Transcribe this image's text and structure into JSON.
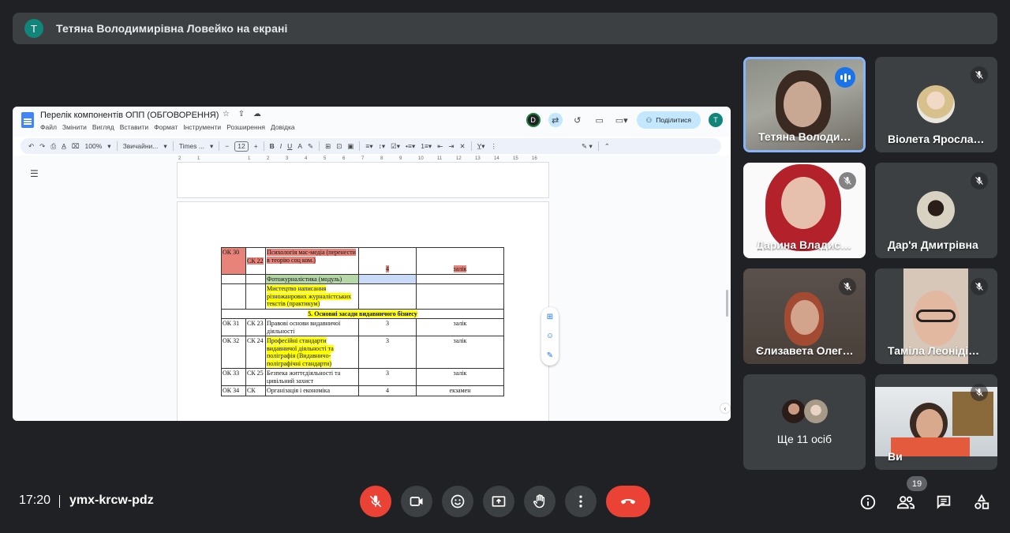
{
  "banner": {
    "avatar_letter": "Т",
    "text": "Тетяна Володимирівна Ловейко на екрані"
  },
  "doc": {
    "title": "Перелік компонентів ОПП (ОБГОВОРЕННЯ)",
    "menu": [
      "Файл",
      "Змінити",
      "Вигляд",
      "Вставити",
      "Формат",
      "Інструменти",
      "Розширення",
      "Довідка"
    ],
    "share_label": "Поділитися",
    "user_avatar": "T",
    "viewer_avatar": "D",
    "zoom": "100%",
    "style": "Звичайни...",
    "font": "Times ...",
    "font_size": "12",
    "ruler": [
      "2",
      "1",
      "1",
      "2",
      "3",
      "4",
      "5",
      "6",
      "7",
      "8",
      "9",
      "10",
      "11",
      "12",
      "13",
      "14",
      "15",
      "16",
      "17",
      "18"
    ],
    "rows": [
      {
        "code": "ОК 30",
        "ck": "СК 22",
        "name": "Психологія мас-медіа (перенести в теорію соц ком.)",
        "credits": "4",
        "form": "залік"
      },
      {
        "code": "",
        "ck": "",
        "name": "Фотожурналістика (модуль)",
        "credits": "",
        "form": ""
      },
      {
        "code": "",
        "ck": "",
        "name": "Мистецтво написання різножанрових журналістських текстів (практикум)",
        "credits": "",
        "form": ""
      },
      {
        "section": "5. Основні засади видавничого бізнесу"
      },
      {
        "code": "ОК 31",
        "ck": "СК 23",
        "name": "Правові основи видавничої діяльності",
        "credits": "3",
        "form": "залік"
      },
      {
        "code": "ОК 32",
        "ck": "СК 24",
        "name": "Професійні стандарти видавничої діяльності та поліграфія (Видавничо-поліграфічні стандарти)",
        "credits": "3",
        "form": "залік"
      },
      {
        "code": "ОК 33",
        "ck": "СК 25",
        "name": "Безпека життєдіяльності та цивільний захист",
        "credits": "3",
        "form": "залік"
      },
      {
        "code": "ОК 34",
        "ck": "СК",
        "name": "Організація і економіка",
        "credits": "4",
        "form": "екзамен"
      }
    ]
  },
  "participants": [
    {
      "name": "Тетяна Володимирівна Ловейко",
      "speaking": true
    },
    {
      "name": "Віолета Ярославівна",
      "muted": true
    },
    {
      "name": "Дарина Владиславівна",
      "muted": true
    },
    {
      "name": "Дар'я Дмитрівна",
      "muted": true
    },
    {
      "name": "Єлизавета Олегівна",
      "muted": true
    },
    {
      "name": "Таміла Леонідівна",
      "muted": true
    },
    {
      "more": "Ще 11 осіб"
    },
    {
      "name": "Ви",
      "muted": true
    }
  ],
  "bottom": {
    "time": "17:20",
    "meeting_code": "ymx-krcw-pdz",
    "participant_count": "19"
  },
  "colors": {
    "background": "#202124",
    "tile": "#3c4043",
    "danger": "#ea4335",
    "active": "#8ab4f8"
  }
}
